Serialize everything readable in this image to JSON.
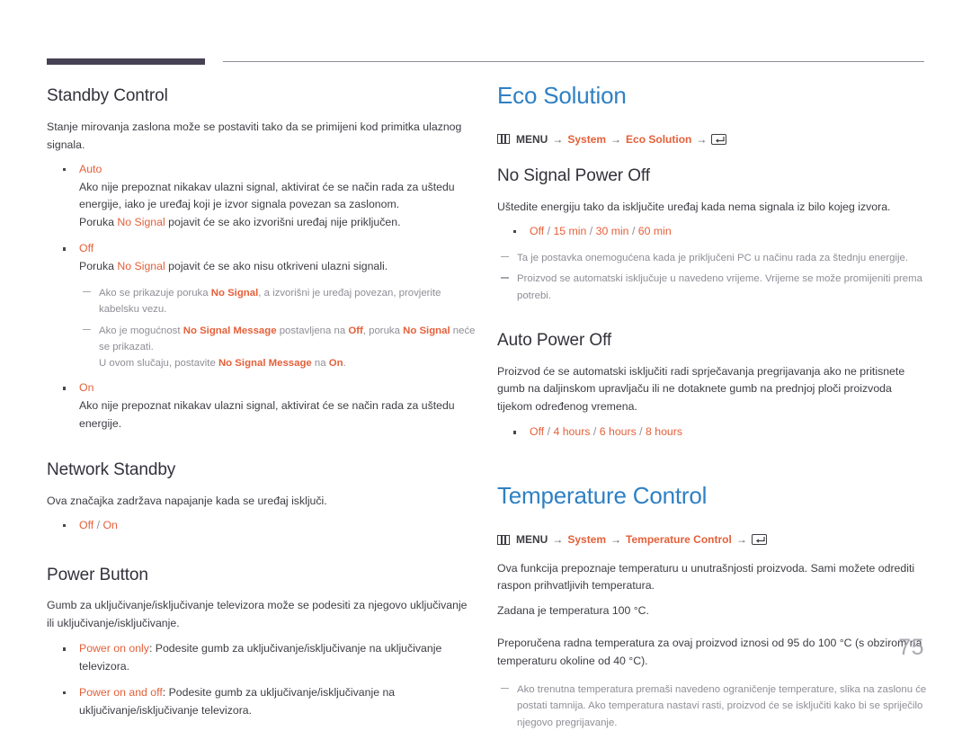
{
  "page": {
    "number": "75",
    "accent_orange": "#e4603a",
    "accent_blue": "#2f80c4",
    "rule_dark": "#474154"
  },
  "left_column": {
    "standby_control": {
      "heading": "Standby Control",
      "intro": "Stanje mirovanja zaslona može se postaviti tako da se primijeni kod primitka ulaznog signala.",
      "items": [
        {
          "label": "Auto",
          "lines": [
            "Ako nije prepoznat nikakav ulazni signal, aktivirat će se način rada za uštedu energije, iako je uređaj koji je izvor signala povezan sa zaslonom.",
            "Poruka No Signal pojavit će se ako izvorišni uređaj nije priključen."
          ],
          "line2_prefix": "Poruka ",
          "line2_accent": "No Signal",
          "line2_suffix": " pojavit će se ako izvorišni uređaj nije priključen."
        },
        {
          "label": "Off",
          "line_prefix": "Poruka ",
          "line_accent": "No Signal",
          "line_suffix": " pojavit će se ako nisu otkriveni ulazni signali."
        },
        {
          "label": "On",
          "line": "Ako nije prepoznat nikakav ulazni signal, aktivirat će se način rada za uštedu energije."
        }
      ],
      "notes": [
        {
          "p1": "Ako se prikazuje poruka ",
          "a1": "No Signal",
          "p2": ", a izvorišni je uređaj povezan, provjerite kabelsku vezu."
        },
        {
          "p1": "Ako je mogućnost ",
          "a1": "No Signal Message",
          "p2": " postavljena na ",
          "a2": "Off",
          "p3": ", poruka ",
          "a3": "No Signal",
          "p4": " neće se prikazati.",
          "extra_p1": "U ovom slučaju, postavite ",
          "extra_a1": "No Signal Message",
          "extra_p2": " na ",
          "extra_a2": "On",
          "extra_p3": "."
        }
      ]
    },
    "network_standby": {
      "heading": "Network Standby",
      "intro": "Ova značajka zadržava napajanje kada se uređaj isključi.",
      "option_values": [
        "Off",
        "On"
      ]
    },
    "power_button": {
      "heading": "Power Button",
      "intro": "Gumb za uključivanje/isključivanje televizora može se podesiti za njegovo uključivanje ili uključivanje/isključivanje.",
      "items": [
        {
          "label": "Power on only",
          "text": ": Podesite gumb za uključivanje/isključivanje na uključivanje televizora."
        },
        {
          "label": "Power on and off",
          "text": ": Podesite gumb za uključivanje/isključivanje na uključivanje/isključivanje televizora."
        }
      ]
    }
  },
  "right_column": {
    "eco_solution": {
      "heading": "Eco Solution",
      "menu_path": {
        "menu_label": "MENU",
        "arrow": "→",
        "step1": "System",
        "step2": "Eco Solution",
        "menu_icon": "menu-grid-icon",
        "enter_icon": "enter-key-icon"
      },
      "no_signal_power_off": {
        "heading": "No Signal Power Off",
        "intro": "Uštedite energiju tako da isključite uređaj kada nema signala iz bilo kojeg izvora.",
        "option_values": [
          "Off",
          "15 min",
          "30 min",
          "60 min"
        ],
        "notes": [
          "Ta je postavka onemogućena kada je priključeni PC u načinu rada za štednju energije.",
          "Proizvod se automatski isključuje u navedeno vrijeme. Vrijeme se može promijeniti prema potrebi."
        ]
      },
      "auto_power_off": {
        "heading": "Auto Power Off",
        "intro": "Proizvod će se automatski isključiti radi sprječavanja pregrijavanja ako ne pritisnete gumb na daljinskom upravljaču ili ne dotaknete gumb na prednjoj ploči proizvoda tijekom određenog vremena.",
        "option_values": [
          "Off",
          "4 hours",
          "6 hours",
          "8 hours"
        ]
      }
    },
    "temperature_control": {
      "heading": "Temperature Control",
      "menu_path": {
        "menu_label": "MENU",
        "arrow": "→",
        "step1": "System",
        "step2": "Temperature Control",
        "menu_icon": "menu-grid-icon",
        "enter_icon": "enter-key-icon"
      },
      "paragraphs": [
        "Ova funkcija prepoznaje temperaturu u unutrašnjosti proizvoda. Sami možete odrediti raspon prihvatljivih temperatura.",
        "Zadana je temperatura 100 °C.",
        "Preporučena radna temperatura za ovaj proizvod iznosi od 95 do 100 °C (s obzirom na temperaturu okoline od 40 °C)."
      ],
      "notes": [
        "Ako trenutna temperatura premaši navedeno ograničenje temperature, slika na zaslonu će postati tamnija. Ako temperatura nastavi rasti, proizvod će se isključiti kako bi se spriječilo njegovo pregrijavanje."
      ]
    }
  }
}
